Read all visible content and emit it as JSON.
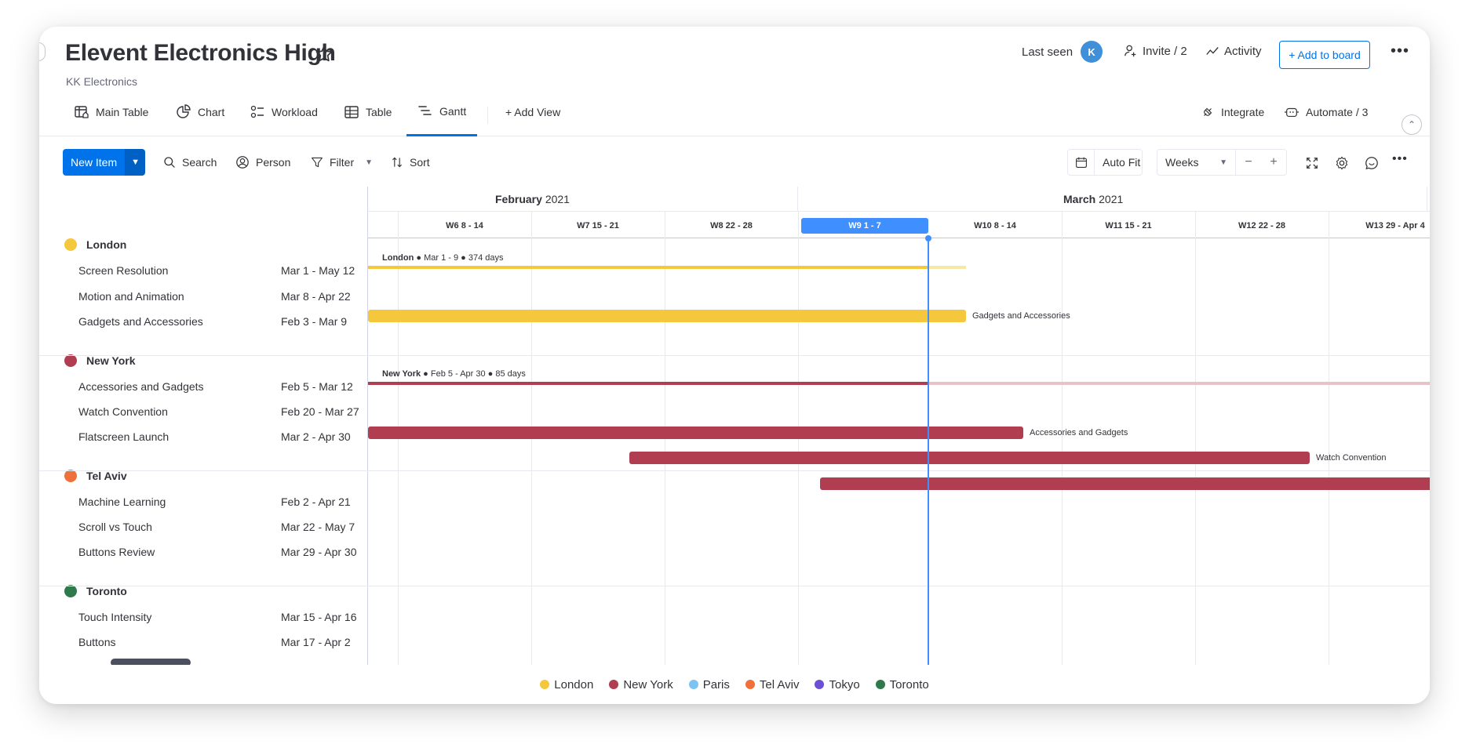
{
  "header": {
    "title": "Elevent Electronics High",
    "subtitle": "KK Electronics",
    "last_seen_label": "Last seen",
    "avatar_initial": "K",
    "invite_label": "Invite / 2",
    "activity_label": "Activity",
    "add_to_board_label": "+ Add to board"
  },
  "tabs": [
    {
      "label": "Main Table",
      "icon": "table-home-icon"
    },
    {
      "label": "Chart",
      "icon": "chart-icon"
    },
    {
      "label": "Workload",
      "icon": "workload-icon"
    },
    {
      "label": "Table",
      "icon": "table-icon"
    },
    {
      "label": "Gantt",
      "icon": "gantt-icon",
      "active": true
    }
  ],
  "add_view_label": "+ Add View",
  "integrate_label": "Integrate",
  "automate_label": "Automate / 3",
  "toolbar": {
    "new_item_label": "New Item",
    "search_label": "Search",
    "person_label": "Person",
    "filter_label": "Filter",
    "sort_label": "Sort",
    "autofit_label": "Auto Fit",
    "scale_value": "Weeks"
  },
  "timeline": {
    "months": [
      {
        "name": "February",
        "year": "2021"
      },
      {
        "name": "March",
        "year": "2021"
      }
    ],
    "weeks": [
      {
        "label": "W6  8 - 14"
      },
      {
        "label": "W7  15 - 21"
      },
      {
        "label": "W8  22 - 28"
      },
      {
        "label": "W9  1 - 7",
        "current": true
      },
      {
        "label": "W10  8 - 14"
      },
      {
        "label": "W11  15 - 21"
      },
      {
        "label": "W12  22 - 28"
      },
      {
        "label": "W13  29 - Apr 4"
      }
    ]
  },
  "groups": [
    {
      "name": "London",
      "color": "#f5c73d",
      "summary": {
        "name": "London",
        "range": "Mar 1 - 9",
        "days": "374 days"
      },
      "items": [
        {
          "name": "Screen Resolution",
          "dates": "Mar 1 - May 12"
        },
        {
          "name": "Motion and Animation",
          "dates": "Mar 8 - Apr 22"
        },
        {
          "name": "Gadgets and Accessories",
          "dates": "Feb 3 - Mar 9",
          "bar_label": "Gadgets and Accessories"
        }
      ]
    },
    {
      "name": "New York",
      "color": "#b03d50",
      "summary": {
        "name": "New York",
        "range": "Feb 5 - Apr 30",
        "days": "85 days"
      },
      "items": [
        {
          "name": "Accessories and Gadgets",
          "dates": "Feb 5 - Mar 12",
          "bar_label": "Accessories and Gadgets"
        },
        {
          "name": "Watch Convention",
          "dates": "Feb 20 - Mar 27",
          "bar_label": "Watch Convention"
        },
        {
          "name": "Flatscreen Launch",
          "dates": "Mar 2 - Apr 30"
        }
      ]
    },
    {
      "name": "Tel Aviv",
      "color": "#f0703a",
      "items": [
        {
          "name": "Machine Learning",
          "dates": "Feb 2 - Apr 21"
        },
        {
          "name": "Scroll vs Touch",
          "dates": "Mar 22 - May 7"
        },
        {
          "name": "Buttons Review",
          "dates": "Mar 29 - Apr 30"
        }
      ]
    },
    {
      "name": "Toronto",
      "color": "#2f7a4a",
      "items": [
        {
          "name": "Touch Intensity",
          "dates": "Mar 15 - Apr 16"
        },
        {
          "name": "Buttons",
          "dates": "Mar 17 - Apr 2"
        }
      ]
    }
  ],
  "legend": [
    {
      "label": "London",
      "color": "#f5c73d"
    },
    {
      "label": "New York",
      "color": "#b03d50"
    },
    {
      "label": "Paris",
      "color": "#7dc3f2"
    },
    {
      "label": "Tel Aviv",
      "color": "#f0703a"
    },
    {
      "label": "Tokyo",
      "color": "#6b4fd6"
    },
    {
      "label": "Toronto",
      "color": "#2f7a4a"
    }
  ]
}
